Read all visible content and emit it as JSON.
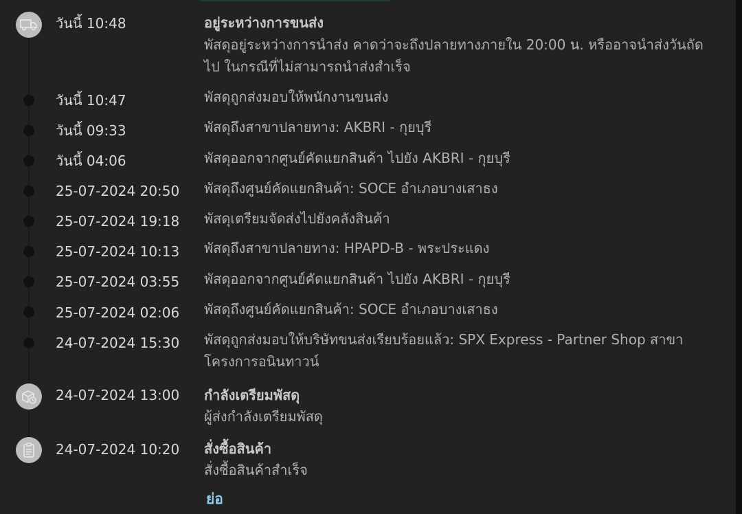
{
  "colors": {
    "background": "#222222",
    "time_text": "#d8d8d8",
    "title_text": "#c8c8c8",
    "desc_text": "#b0b0b0",
    "icon_circle": "#bdbdbd",
    "collapse_link": "#8ec9ee"
  },
  "events": [
    {
      "time": "วันนี้ 10:48",
      "title": "อยู่ระหว่างการขนส่ง",
      "desc": "พัสดุอยู่ระหว่างการนำส่ง คาดว่าจะถึงปลายทางภายใน 20:00 น. หรืออาจนำส่งวันถัดไป ในกรณีที่ไม่สามารถนำส่งสำเร็จ",
      "icon": "truck-icon"
    },
    {
      "time": "วันนี้ 10:47",
      "desc": "พัสดุถูกส่งมอบให้พนักงานขนส่ง"
    },
    {
      "time": "วันนี้ 09:33",
      "desc": "พัสดุถึงสาขาปลายทาง: AKBRI - กุยบุรี"
    },
    {
      "time": "วันนี้ 04:06",
      "desc": "พัสดุออกจากศูนย์คัดแยกสินค้า ไปยัง AKBRI - กุยบุรี"
    },
    {
      "time": "25-07-2024 20:50",
      "desc": "พัสดุถึงศูนย์คัดแยกสินค้า: SOCE อำเภอบางเสาธง"
    },
    {
      "time": "25-07-2024 19:18",
      "desc": "พัสดุเตรียมจัดส่งไปยังคลังสินค้า"
    },
    {
      "time": "25-07-2024 10:13",
      "desc": "พัสดุถึงสาขาปลายทาง: HPAPD-B - พระประแดง"
    },
    {
      "time": "25-07-2024 03:55",
      "desc": "พัสดุออกจากศูนย์คัดแยกสินค้า ไปยัง AKBRI - กุยบุรี"
    },
    {
      "time": "25-07-2024 02:06",
      "desc": "พัสดุถึงศูนย์คัดแยกสินค้า: SOCE อำเภอบางเสาธง"
    },
    {
      "time": "24-07-2024 15:30",
      "desc": "พัสดุถูกส่งมอบให้บริษัทขนส่งเรียบร้อยแล้ว: SPX Express - Partner Shop สาขาโครงการอนินทาวน์"
    },
    {
      "time": "24-07-2024 13:00",
      "title": "กำลังเตรียมพัสดุ",
      "desc": "ผู้ส่งกำลังเตรียมพัสดุ",
      "icon": "package-clock-icon"
    },
    {
      "time": "24-07-2024 10:20",
      "title": "สั่งซื้อสินค้า",
      "desc": "สั่งซื้อสินค้าสำเร็จ",
      "icon": "clipboard-icon"
    }
  ],
  "collapse_label": "ย่อ"
}
